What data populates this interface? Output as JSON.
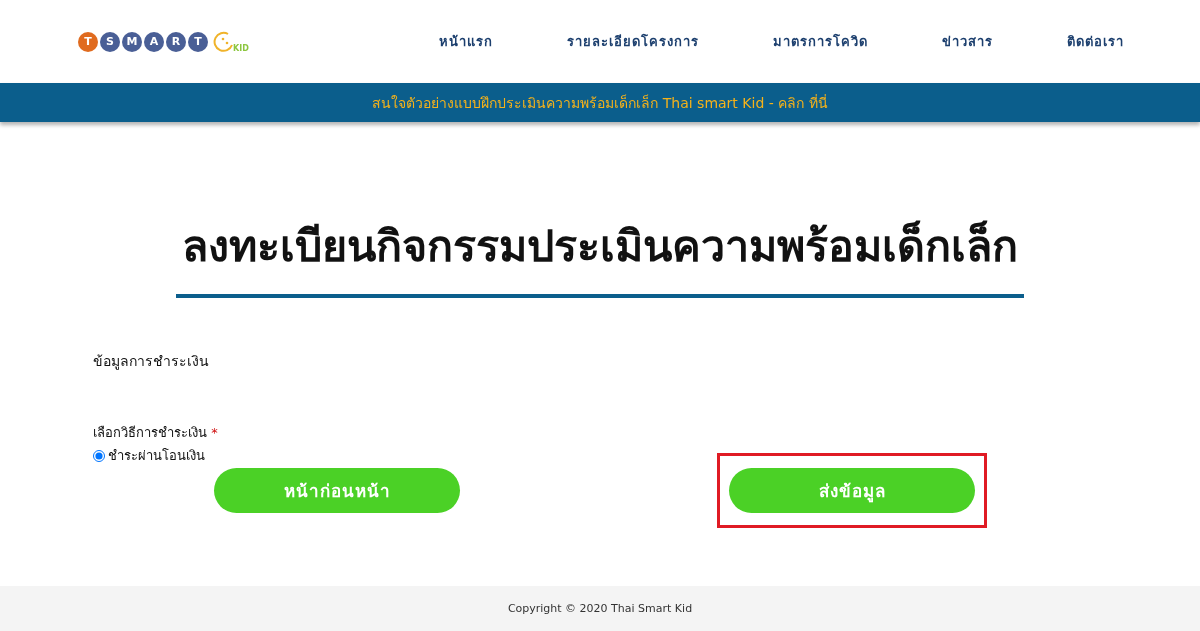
{
  "logo": {
    "letters": [
      {
        "text": "T",
        "color": "#e06b1f"
      },
      {
        "text": "S",
        "color": "#4a5f96"
      },
      {
        "text": "M",
        "color": "#4a5f96"
      },
      {
        "text": "A",
        "color": "#4a5f96"
      },
      {
        "text": "R",
        "color": "#4a5f96"
      },
      {
        "text": "T",
        "color": "#4a5f96"
      }
    ],
    "kid": "KID"
  },
  "nav": [
    "หน้าแรก",
    "รายละเอียดโครงการ",
    "มาตรการโควิด",
    "ข่าวสาร",
    "ติดต่อเรา"
  ],
  "banner": "สนใจตัวอย่างแบบฝึกประเมินความพร้อมเด็กเล็ก Thai smart Kid - คลิก ที่นี่",
  "title": "ลงทะเบียนกิจกรรมประเมินความพร้อมเด็กเล็ก",
  "section": "ข้อมูลการชำระเงิน",
  "payment": {
    "label": "เลือกวิธีการชำระเงิน",
    "required": "*",
    "options": [
      {
        "label": "ชำระผ่านโอนเงิน",
        "selected": true
      }
    ]
  },
  "buttons": [
    {
      "label": "หน้าก่อนหน้า",
      "highlighted": false
    },
    {
      "label": "ส่งข้อมูล",
      "highlighted": true
    }
  ],
  "footer": "Copyright © 2020 Thai Smart Kid"
}
